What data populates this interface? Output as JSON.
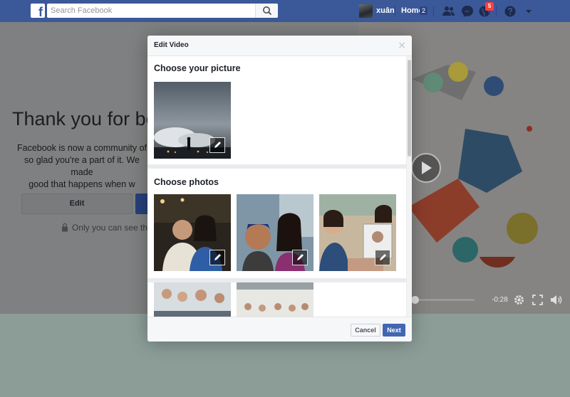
{
  "topbar": {
    "logo_letter": "f",
    "search_placeholder": "Search Facebook",
    "profile_name": "xuân",
    "home_label": "Home",
    "home_count": "2",
    "notifications_count": "5",
    "brand_color": "#3b5998"
  },
  "background_page": {
    "title": "Thank you for bei",
    "body_lines": [
      "Facebook is now a community of",
      "so glad you're a part of it. We made",
      "good that happens when w"
    ],
    "edit_button": "Edit",
    "privacy_text": "Only you can see this u",
    "video_time": "-0:28"
  },
  "modal": {
    "title": "Edit Video",
    "close_glyph": "×",
    "section_picture": "Choose your picture",
    "section_photos": "Choose photos",
    "cancel_label": "Cancel",
    "next_label": "Next",
    "accent_color": "#4267b2"
  }
}
